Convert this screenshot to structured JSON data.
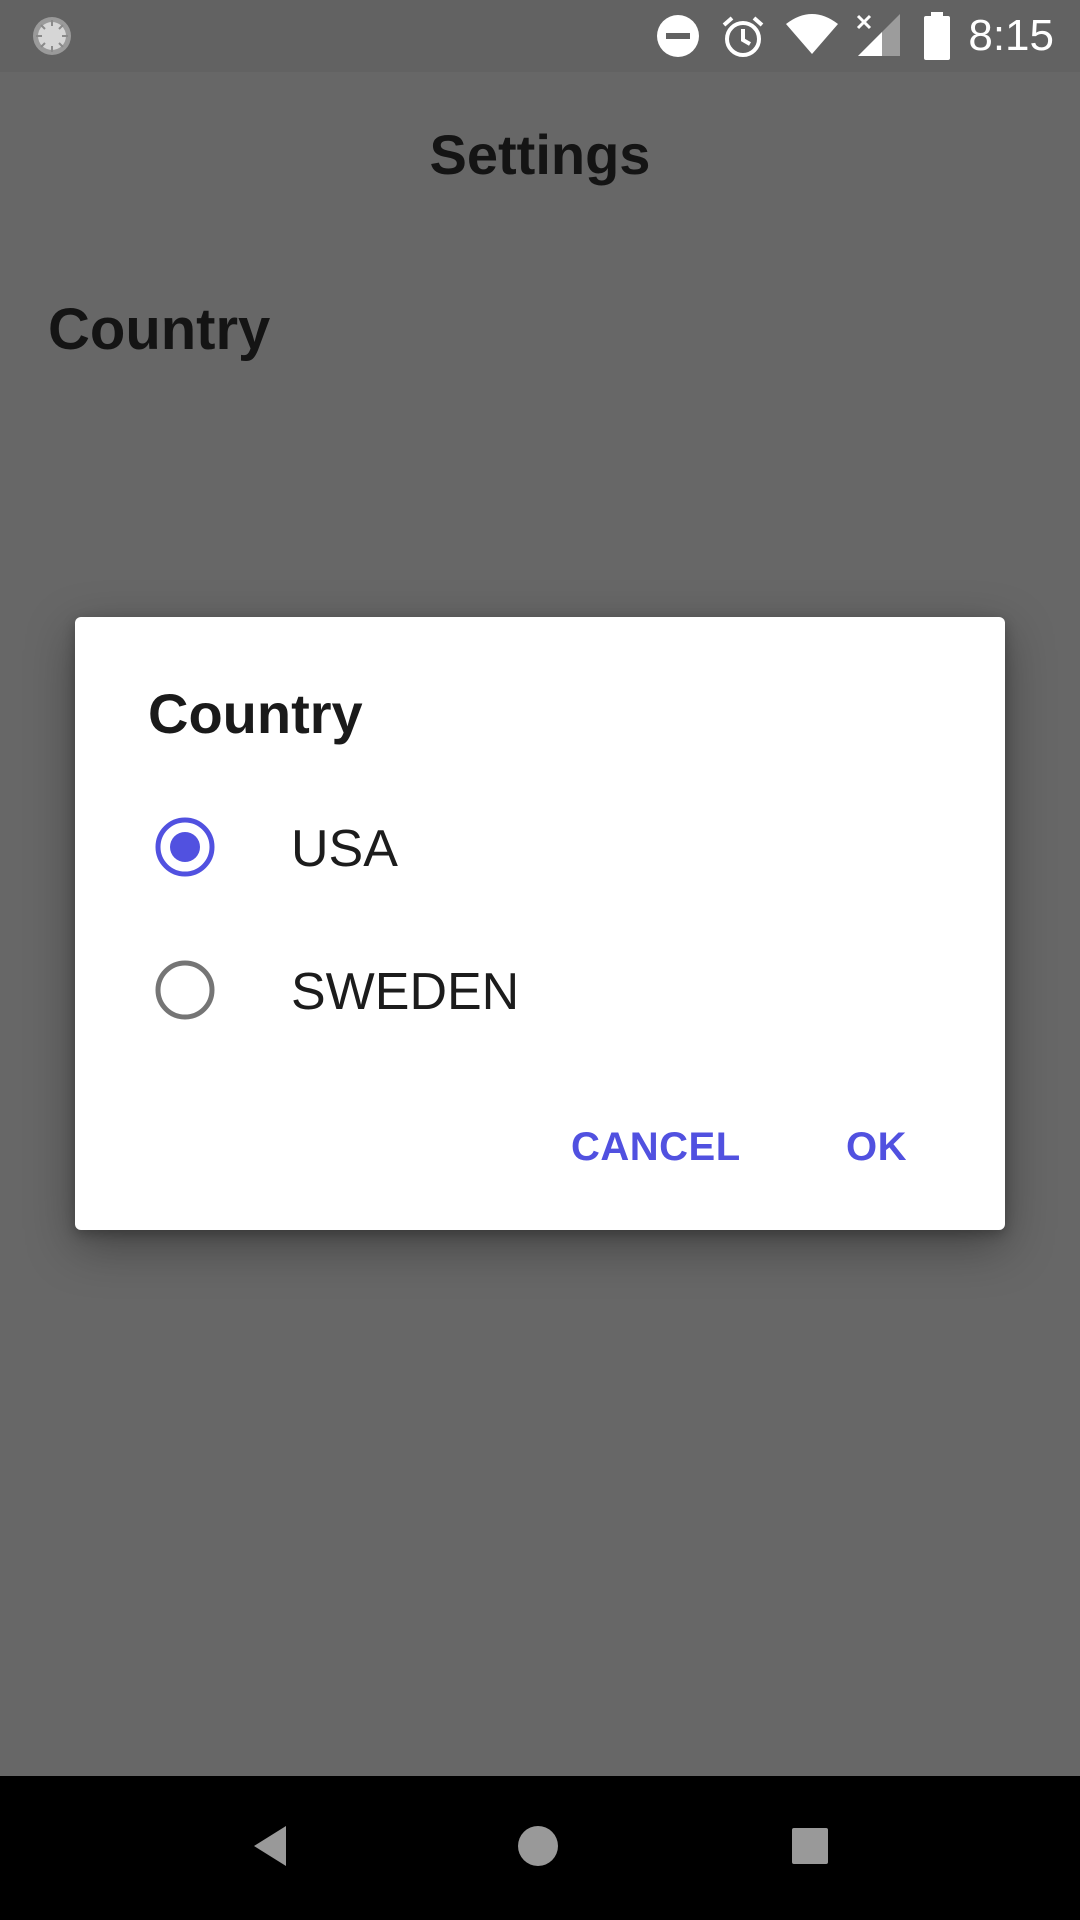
{
  "status_bar": {
    "time": "8:15",
    "icons": [
      "loading-indicator-icon",
      "do-not-disturb-icon",
      "alarm-icon",
      "wifi-icon",
      "signal-no-data-icon",
      "battery-icon"
    ]
  },
  "app": {
    "title": "Settings",
    "preference_label": "Country"
  },
  "dialog": {
    "title": "Country",
    "options": [
      {
        "label": "USA",
        "selected": true
      },
      {
        "label": "SWEDEN",
        "selected": false
      }
    ],
    "cancel_label": "CANCEL",
    "ok_label": "OK"
  },
  "nav_bar": {
    "buttons": [
      "back-icon",
      "home-icon",
      "recents-icon"
    ]
  },
  "colors": {
    "accent": "#5151e0",
    "scrim_background": "#676767",
    "dialog_background": "#ffffff"
  }
}
